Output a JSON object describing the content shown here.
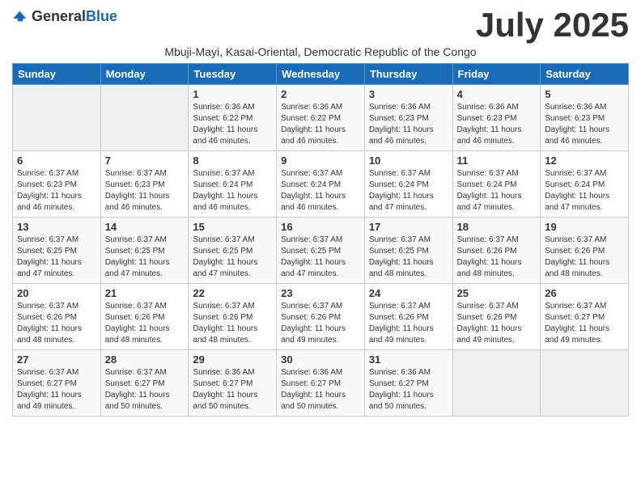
{
  "header": {
    "logo_general": "General",
    "logo_blue": "Blue",
    "month_year": "July 2025",
    "subtitle": "Mbuji-Mayi, Kasai-Oriental, Democratic Republic of the Congo"
  },
  "weekdays": [
    "Sunday",
    "Monday",
    "Tuesday",
    "Wednesday",
    "Thursday",
    "Friday",
    "Saturday"
  ],
  "weeks": [
    [
      {
        "day": "",
        "info": ""
      },
      {
        "day": "",
        "info": ""
      },
      {
        "day": "1",
        "info": "Sunrise: 6:36 AM\nSunset: 6:22 PM\nDaylight: 11 hours and 46 minutes."
      },
      {
        "day": "2",
        "info": "Sunrise: 6:36 AM\nSunset: 6:22 PM\nDaylight: 11 hours and 46 minutes."
      },
      {
        "day": "3",
        "info": "Sunrise: 6:36 AM\nSunset: 6:23 PM\nDaylight: 11 hours and 46 minutes."
      },
      {
        "day": "4",
        "info": "Sunrise: 6:36 AM\nSunset: 6:23 PM\nDaylight: 11 hours and 46 minutes."
      },
      {
        "day": "5",
        "info": "Sunrise: 6:36 AM\nSunset: 6:23 PM\nDaylight: 11 hours and 46 minutes."
      }
    ],
    [
      {
        "day": "6",
        "info": "Sunrise: 6:37 AM\nSunset: 6:23 PM\nDaylight: 11 hours and 46 minutes."
      },
      {
        "day": "7",
        "info": "Sunrise: 6:37 AM\nSunset: 6:23 PM\nDaylight: 11 hours and 46 minutes."
      },
      {
        "day": "8",
        "info": "Sunrise: 6:37 AM\nSunset: 6:24 PM\nDaylight: 11 hours and 46 minutes."
      },
      {
        "day": "9",
        "info": "Sunrise: 6:37 AM\nSunset: 6:24 PM\nDaylight: 11 hours and 46 minutes."
      },
      {
        "day": "10",
        "info": "Sunrise: 6:37 AM\nSunset: 6:24 PM\nDaylight: 11 hours and 47 minutes."
      },
      {
        "day": "11",
        "info": "Sunrise: 6:37 AM\nSunset: 6:24 PM\nDaylight: 11 hours and 47 minutes."
      },
      {
        "day": "12",
        "info": "Sunrise: 6:37 AM\nSunset: 6:24 PM\nDaylight: 11 hours and 47 minutes."
      }
    ],
    [
      {
        "day": "13",
        "info": "Sunrise: 6:37 AM\nSunset: 6:25 PM\nDaylight: 11 hours and 47 minutes."
      },
      {
        "day": "14",
        "info": "Sunrise: 6:37 AM\nSunset: 6:25 PM\nDaylight: 11 hours and 47 minutes."
      },
      {
        "day": "15",
        "info": "Sunrise: 6:37 AM\nSunset: 6:25 PM\nDaylight: 11 hours and 47 minutes."
      },
      {
        "day": "16",
        "info": "Sunrise: 6:37 AM\nSunset: 6:25 PM\nDaylight: 11 hours and 47 minutes."
      },
      {
        "day": "17",
        "info": "Sunrise: 6:37 AM\nSunset: 6:25 PM\nDaylight: 11 hours and 48 minutes."
      },
      {
        "day": "18",
        "info": "Sunrise: 6:37 AM\nSunset: 6:26 PM\nDaylight: 11 hours and 48 minutes."
      },
      {
        "day": "19",
        "info": "Sunrise: 6:37 AM\nSunset: 6:26 PM\nDaylight: 11 hours and 48 minutes."
      }
    ],
    [
      {
        "day": "20",
        "info": "Sunrise: 6:37 AM\nSunset: 6:26 PM\nDaylight: 11 hours and 48 minutes."
      },
      {
        "day": "21",
        "info": "Sunrise: 6:37 AM\nSunset: 6:26 PM\nDaylight: 11 hours and 48 minutes."
      },
      {
        "day": "22",
        "info": "Sunrise: 6:37 AM\nSunset: 6:26 PM\nDaylight: 11 hours and 48 minutes."
      },
      {
        "day": "23",
        "info": "Sunrise: 6:37 AM\nSunset: 6:26 PM\nDaylight: 11 hours and 49 minutes."
      },
      {
        "day": "24",
        "info": "Sunrise: 6:37 AM\nSunset: 6:26 PM\nDaylight: 11 hours and 49 minutes."
      },
      {
        "day": "25",
        "info": "Sunrise: 6:37 AM\nSunset: 6:26 PM\nDaylight: 11 hours and 49 minutes."
      },
      {
        "day": "26",
        "info": "Sunrise: 6:37 AM\nSunset: 6:27 PM\nDaylight: 11 hours and 49 minutes."
      }
    ],
    [
      {
        "day": "27",
        "info": "Sunrise: 6:37 AM\nSunset: 6:27 PM\nDaylight: 11 hours and 49 minutes."
      },
      {
        "day": "28",
        "info": "Sunrise: 6:37 AM\nSunset: 6:27 PM\nDaylight: 11 hours and 50 minutes."
      },
      {
        "day": "29",
        "info": "Sunrise: 6:36 AM\nSunset: 6:27 PM\nDaylight: 11 hours and 50 minutes."
      },
      {
        "day": "30",
        "info": "Sunrise: 6:36 AM\nSunset: 6:27 PM\nDaylight: 11 hours and 50 minutes."
      },
      {
        "day": "31",
        "info": "Sunrise: 6:36 AM\nSunset: 6:27 PM\nDaylight: 11 hours and 50 minutes."
      },
      {
        "day": "",
        "info": ""
      },
      {
        "day": "",
        "info": ""
      }
    ]
  ]
}
